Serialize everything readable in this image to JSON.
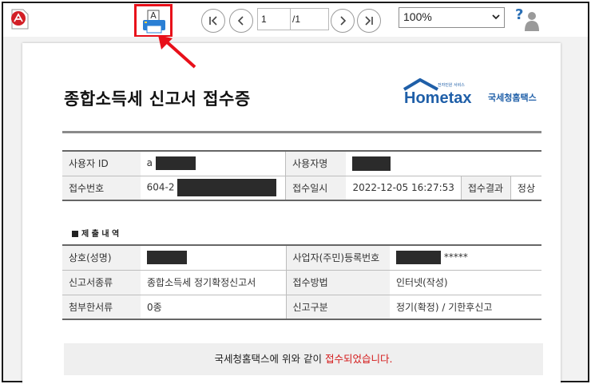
{
  "toolbar": {
    "page_current": "1",
    "page_total": "/1",
    "zoom": "100%",
    "print_icon_letter": "A"
  },
  "doc": {
    "title": "종합소득세 신고서 접수증",
    "logo_small_text": "전자민원 서비스",
    "logo_main": "Hometax",
    "logo_main_e": "e",
    "logo_suffix": "국세청홈택스"
  },
  "table1": {
    "user_id_label": "사용자 ID",
    "user_id_value": "a",
    "user_name_label": "사용자명",
    "receipt_no_label": "접수번호",
    "receipt_no_value": "604-2",
    "receipt_date_label": "접수일시",
    "receipt_date_value": "2022-12-05 16:27:53",
    "receipt_result_label": "접수결과",
    "receipt_result_value": "정상"
  },
  "section": {
    "label": "제 출 내 역"
  },
  "table2": {
    "company_label": "상호(성명)",
    "biz_no_label": "사업자(주민)등록번호",
    "biz_no_suffix": "*****",
    "form_type_label": "신고서종류",
    "form_type_value": "종합소득세 정기확정신고서",
    "method_label": "접수방법",
    "method_value": "인터넷(작성)",
    "attach_label": "첨부한서류",
    "attach_value": "0종",
    "filing_label": "신고구분",
    "filing_value": "정기(확정) / 기한후신고"
  },
  "banner": {
    "text_prefix": "국세청홈택스에 위와 같이 ",
    "text_highlight": "접수되었습니다."
  },
  "colors": {
    "highlight_red": "#e8101a",
    "banner_red": "#d41818",
    "logo_blue": "#1f5fa8"
  }
}
